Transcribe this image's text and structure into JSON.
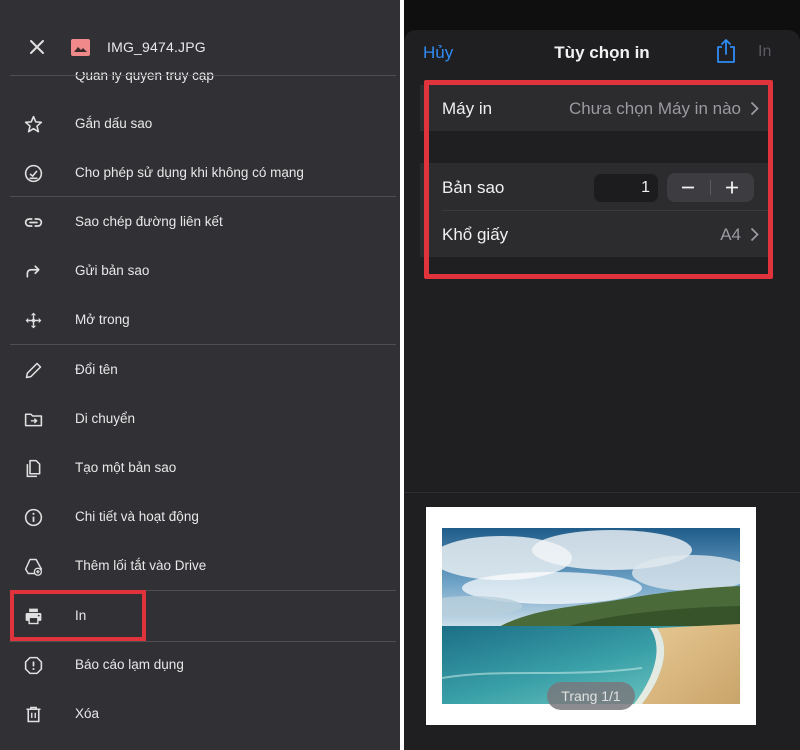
{
  "drive_panel": {
    "file_name": "IMG_9474.JPG",
    "partial_item_label": "Quản lý quyền truy cập",
    "menu_items": [
      {
        "label": "Gắn dấu sao",
        "icon": "star-icon"
      },
      {
        "label": "Cho phép sử dụng khi không có mạng",
        "icon": "offline-check-icon"
      },
      {
        "label": "Sao chép đường liên kết",
        "icon": "link-icon"
      },
      {
        "label": "Gửi bản sao",
        "icon": "forward-icon"
      },
      {
        "label": "Mở trong",
        "icon": "move-arrows-icon"
      },
      {
        "label": "Đổi tên",
        "icon": "pencil-icon"
      },
      {
        "label": "Di chuyển",
        "icon": "folder-move-icon"
      },
      {
        "label": "Tạo một bản sao",
        "icon": "copy-icon"
      },
      {
        "label": "Chi tiết và hoạt động",
        "icon": "info-icon"
      },
      {
        "label": "Thêm lối tắt vào Drive",
        "icon": "drive-shortcut-icon"
      },
      {
        "label": "In",
        "icon": "printer-icon"
      },
      {
        "label": "Báo cáo lạm dụng",
        "icon": "report-icon"
      },
      {
        "label": "Xóa",
        "icon": "trash-icon"
      }
    ]
  },
  "print_options": {
    "cancel_label": "Hủy",
    "title": "Tùy chọn in",
    "print_label": "In",
    "printer_label": "Máy in",
    "printer_value": "Chưa chọn Máy in nào",
    "copies_label": "Bản sao",
    "copies_value": "1",
    "paper_label": "Khổ giấy",
    "paper_value": "A4",
    "page_indicator": "Trang 1/1"
  },
  "colors": {
    "accent_blue": "#2f8bf5",
    "highlight_red": "#e0333c",
    "panel_bg": "#313135",
    "sheet_bg": "#1f1f22"
  }
}
